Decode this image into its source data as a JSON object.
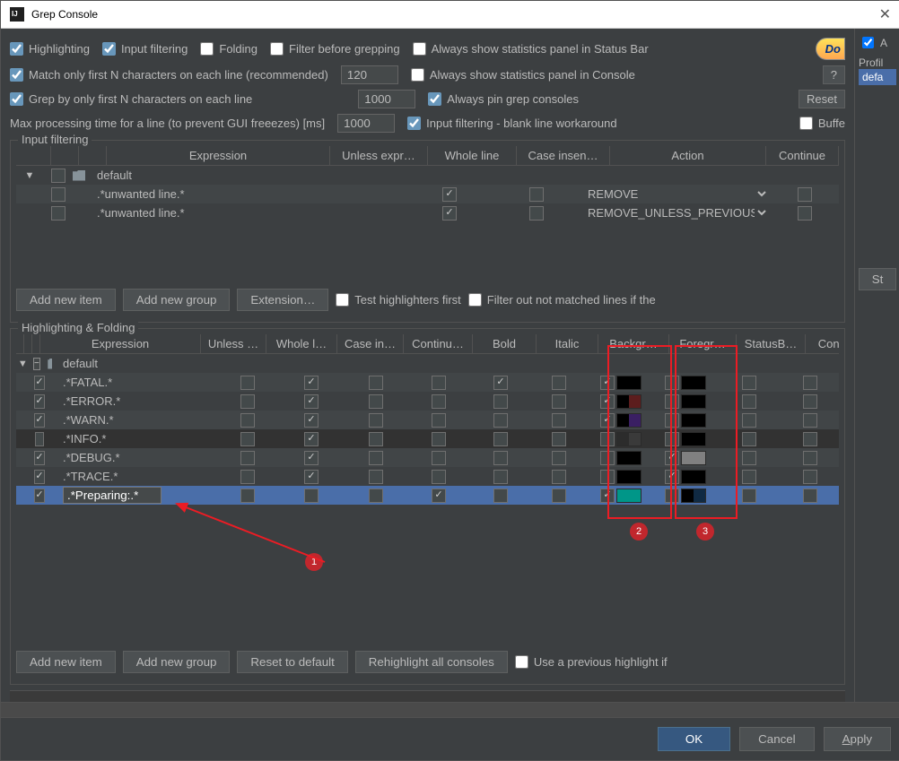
{
  "title": "Grep Console",
  "top": {
    "highlighting": "Highlighting",
    "inputFiltering": "Input filtering",
    "folding": "Folding",
    "filterBefore": "Filter before grepping",
    "statsBar": "Always show statistics panel in Status Bar",
    "matchFirstN": "Match only first N characters on each line (recommended)",
    "matchN": "120",
    "statsConsole": "Always show statistics panel in Console",
    "grepFirstN": "Grep by only first N characters on each line",
    "grepN": "1000",
    "pin": "Always pin grep consoles",
    "reset": "Reset",
    "maxTime": "Max processing time for a line (to prevent GUI freeezes) [ms]",
    "maxTimeN": "1000",
    "blankWorkaround": "Input filtering - blank line workaround",
    "buffer": "Buffe",
    "donate": "Do",
    "help": "?"
  },
  "ifGroup": {
    "legend": "Input filtering",
    "cols": [
      "",
      "",
      "",
      "Expression",
      "Unless expr…",
      "Whole line",
      "Case insen…",
      "Action",
      "Continue"
    ],
    "groupName": "default",
    "rows": [
      {
        "expr": ".*unwanted line.*",
        "whole": true,
        "action": "REMOVE"
      },
      {
        "expr": ".*unwanted line.*",
        "whole": true,
        "action": "REMOVE_UNLESS_PREVIOUS… "
      }
    ],
    "btns": {
      "add": "Add new item",
      "group": "Add new group",
      "ext": "Extension…",
      "test": "Test highlighters first",
      "filter": "Filter out not matched lines if the"
    }
  },
  "hlGroup": {
    "legend": "Highlighting & Folding",
    "cols": [
      "",
      "",
      "",
      "Expression",
      "Unless …",
      "Whole l…",
      "Case in…",
      "Continu…",
      "Bold",
      "Italic",
      "Backgr…",
      "Foregr…",
      "StatusB…",
      "Consol"
    ],
    "groupName": "default",
    "rows": [
      {
        "en": true,
        "expr": ".*FATAL.*",
        "whole": true,
        "bold": true,
        "bgck": true,
        "bg1": "#000",
        "bg2": "#000",
        "fg1": "#000",
        "fg2": "#000"
      },
      {
        "en": true,
        "expr": ".*ERROR.*",
        "whole": true,
        "bgck": true,
        "bg1": "#000",
        "bg2": "#5c1d1d",
        "fg1": "#000",
        "fg2": "#000"
      },
      {
        "en": true,
        "expr": ".*WARN.*",
        "whole": true,
        "bgck": true,
        "bg1": "#000",
        "bg2": "#3a1f63",
        "fg1": "#000",
        "fg2": "#000"
      },
      {
        "en": false,
        "dark": true,
        "expr": ".*INFO.*",
        "whole": true,
        "bg1": "#2c2c2c",
        "bg2": "#3a3a3a",
        "fg1": "#000",
        "fg2": "#000"
      },
      {
        "en": true,
        "expr": ".*DEBUG.*",
        "whole": true,
        "bg1": "#000",
        "bg2": "#000",
        "fgck": true,
        "fg1": "#808080",
        "fg2": "#808080"
      },
      {
        "en": true,
        "expr": ".*TRACE.*",
        "whole": true,
        "bg1": "#000",
        "bg2": "#000",
        "fgck": true,
        "fg1": "#000",
        "fg2": "#000"
      },
      {
        "en": true,
        "sel": true,
        "expr": ".*Preparing:.*",
        "cont": true,
        "bgck": true,
        "bg1": "#009688",
        "bg2": "#009688",
        "fg1": "#000",
        "fg2": "#102a43"
      }
    ],
    "btns": {
      "add": "Add new item",
      "group": "Add new group",
      "reset": "Reset to default",
      "rehl": "Rehighlight all consoles",
      "prev": "Use a previous highlight if"
    }
  },
  "footer": {
    "ok": "OK",
    "cancel": "Cancel",
    "apply": "Apply"
  },
  "right": {
    "a": "A",
    "profiles": "Profil",
    "default": "defa",
    "st": "St"
  },
  "badges": {
    "b1": "1",
    "b2": "2",
    "b3": "3"
  }
}
